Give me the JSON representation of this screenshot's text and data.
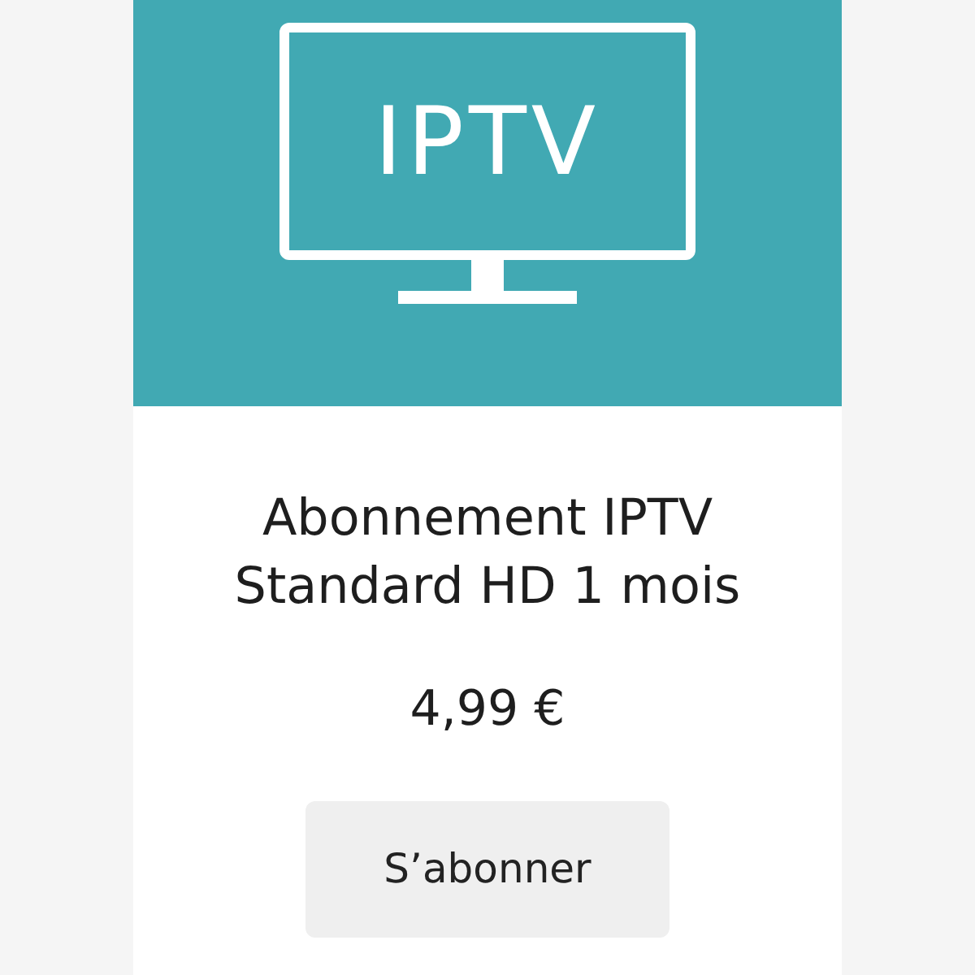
{
  "banner": {
    "logo_text": "IPTV"
  },
  "product": {
    "title_lines": [
      "Abonnement IPTV",
      "Standard HD 1 mois"
    ],
    "price": "4,99 €"
  },
  "button": {
    "label": "S’abonner"
  }
}
